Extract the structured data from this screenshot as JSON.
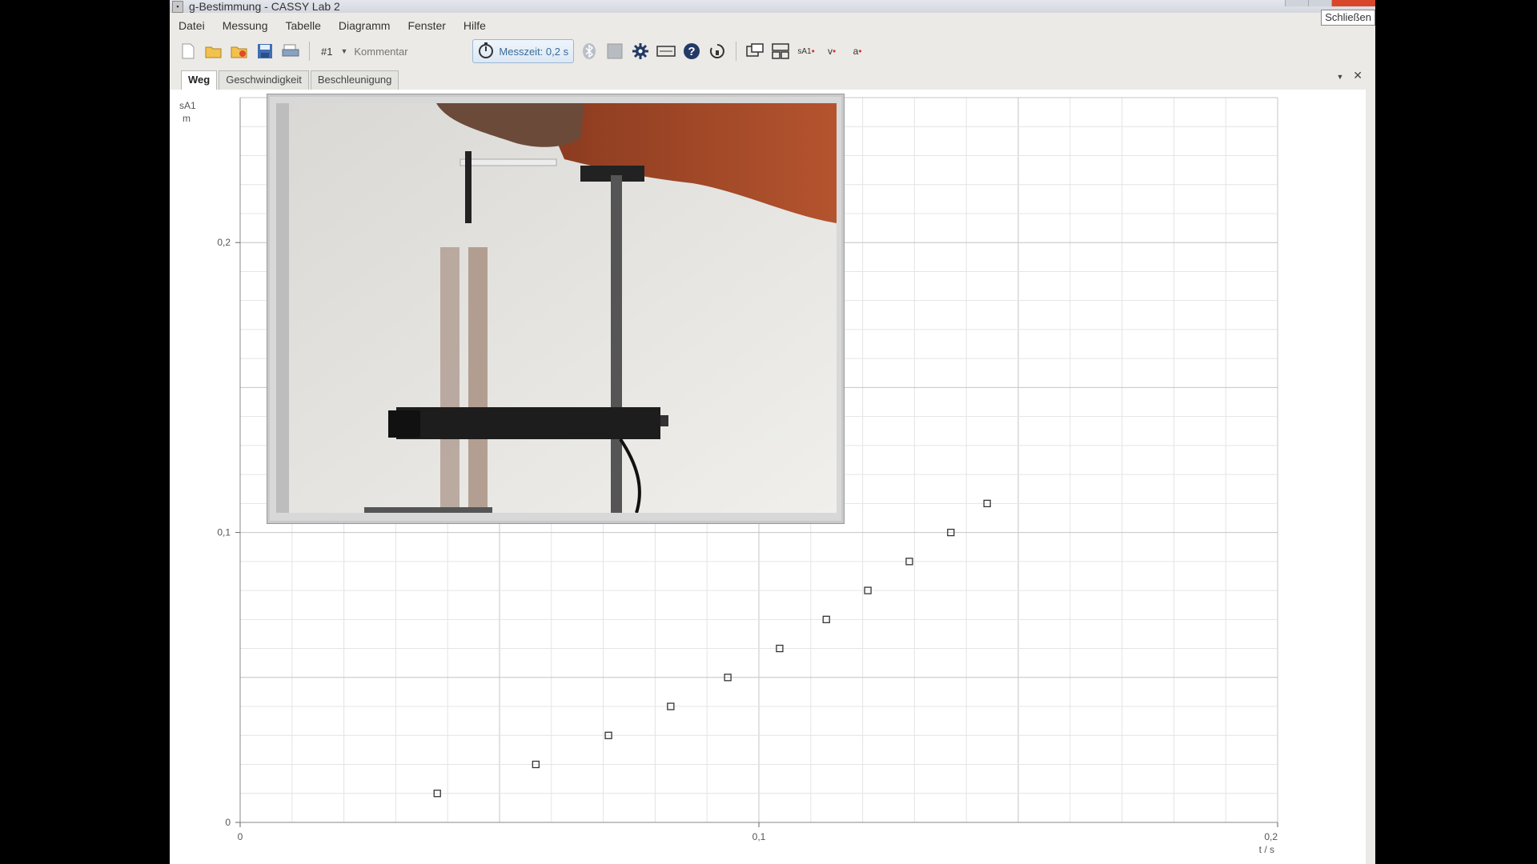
{
  "window": {
    "title": "g-Bestimmung - CASSY Lab 2",
    "close_tooltip": "Schließen"
  },
  "menu": [
    "Datei",
    "Messung",
    "Tabelle",
    "Diagramm",
    "Fenster",
    "Hilfe"
  ],
  "toolbar": {
    "dataset": "#1",
    "comment_placeholder": "Kommentar",
    "measure_time": "Messzeit: 0,2 s",
    "icons": [
      "new-file-icon",
      "open-folder-icon",
      "open-example-icon",
      "save-icon",
      "print-icon",
      "stopwatch-icon",
      "bluetooth-icon",
      "grid-icon",
      "gear-icon",
      "keyboard-icon",
      "help-icon",
      "reset-icon",
      "window-a-icon",
      "window-b-icon",
      "sa1-icon",
      "v-icon",
      "a-icon"
    ],
    "sa1_label": "sA1",
    "v_label": "v",
    "a_label": "a"
  },
  "tabs": [
    {
      "label": "Weg",
      "active": true
    },
    {
      "label": "Geschwindigkeit",
      "active": false
    },
    {
      "label": "Beschleunigung",
      "active": false
    }
  ],
  "chart_data": {
    "type": "scatter",
    "ylabel": "sA1",
    "yunit": "m",
    "xlabel": "t / s",
    "xlim": [
      0,
      0.2
    ],
    "ylim": [
      0,
      0.25
    ],
    "xticks": [
      {
        "v": 0,
        "label": "0"
      },
      {
        "v": 0.1,
        "label": "0,1"
      },
      {
        "v": 0.2,
        "label": "0,2"
      }
    ],
    "yticks": [
      {
        "v": 0,
        "label": "0"
      },
      {
        "v": 0.1,
        "label": "0,1"
      },
      {
        "v": 0.2,
        "label": "0,2"
      }
    ],
    "points": [
      [
        0.038,
        0.01
      ],
      [
        0.057,
        0.02
      ],
      [
        0.071,
        0.03
      ],
      [
        0.083,
        0.04
      ],
      [
        0.094,
        0.05
      ],
      [
        0.104,
        0.06
      ],
      [
        0.113,
        0.07
      ],
      [
        0.121,
        0.08
      ],
      [
        0.129,
        0.09
      ],
      [
        0.137,
        0.1
      ],
      [
        0.144,
        0.11
      ]
    ],
    "grid": true
  }
}
